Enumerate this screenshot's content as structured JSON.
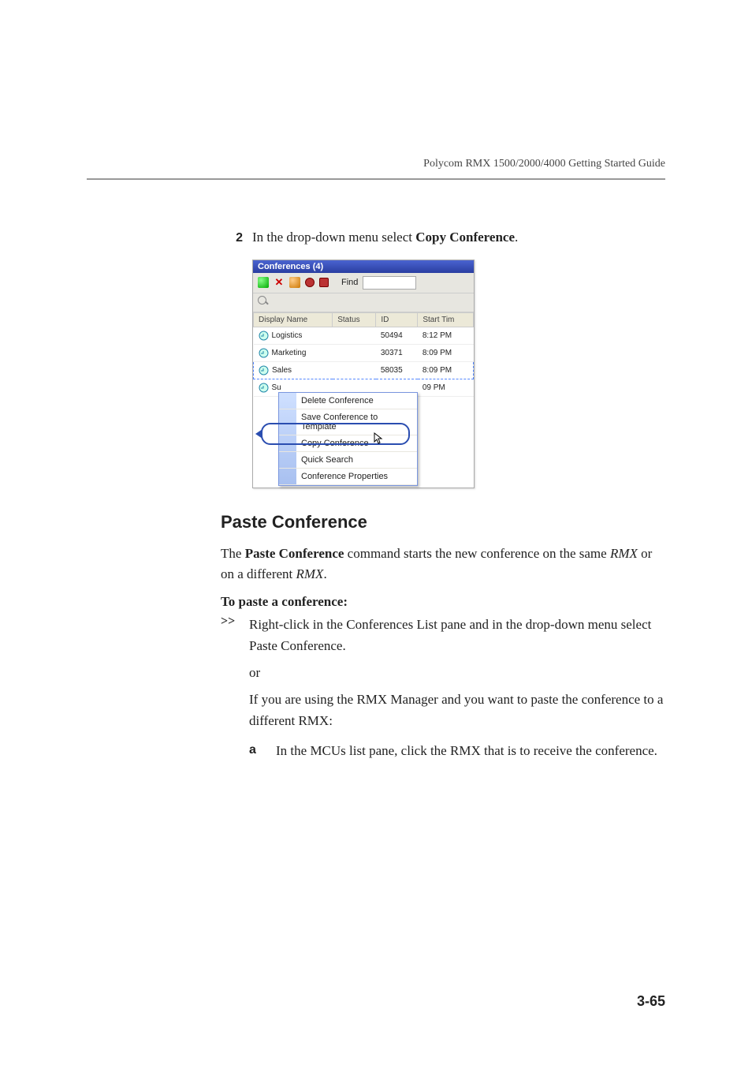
{
  "header": {
    "running_head": "Polycom RMX 1500/2000/4000 Getting Started Guide"
  },
  "step2": {
    "num": "2",
    "pre": "In the drop-down menu select ",
    "bold": "Copy Conference",
    "post": "."
  },
  "shot": {
    "title": "Conferences (4)",
    "find_label": "Find",
    "find_value": "",
    "columns": {
      "name": "Display Name",
      "status": "Status",
      "id": "ID",
      "start": "Start Tim"
    },
    "rows": [
      {
        "name": "Logistics",
        "id": "50494",
        "start": "8:12 PM"
      },
      {
        "name": "Marketing",
        "id": "30371",
        "start": "8:09 PM"
      },
      {
        "name": "Sales",
        "id": "58035",
        "start": "8:09 PM"
      },
      {
        "name": "Su",
        "id": "",
        "start": "09 PM"
      }
    ],
    "menu": {
      "delete": "Delete Conference",
      "save": "Save Conference to Template",
      "copy": "Copy Conference",
      "quick": "Quick Search",
      "props": "Conference Properties"
    }
  },
  "paste": {
    "heading": "Paste Conference",
    "p1_a": "The ",
    "p1_b": "Paste Conference",
    "p1_c": " command starts the new conference on the same ",
    "p1_d": "RMX",
    "p1_e": " or on a different ",
    "p1_f": "RMX",
    "p1_g": ".",
    "proc_title": "To paste a conference:",
    "marker": ">>",
    "s1_a": "Right-click in the ",
    "s1_b": "Conferences List",
    "s1_c": " pane and in the drop-down menu select",
    "s1_d": "Paste Conference",
    "s1_e": ".",
    "or": "or",
    "s2_a": "If you are using the ",
    "s2_b": "RMX Manager",
    "s2_c": " and you want to paste the conference to a different ",
    "s2_d": "RMX",
    "s2_e": ":",
    "sub_marker": "a",
    "sub_a": "In the ",
    "sub_b": "MCUs",
    "sub_c": " list pane, click the ",
    "sub_d": "RMX",
    "sub_e": " that is to receive the conference."
  },
  "page_num": "3-65"
}
